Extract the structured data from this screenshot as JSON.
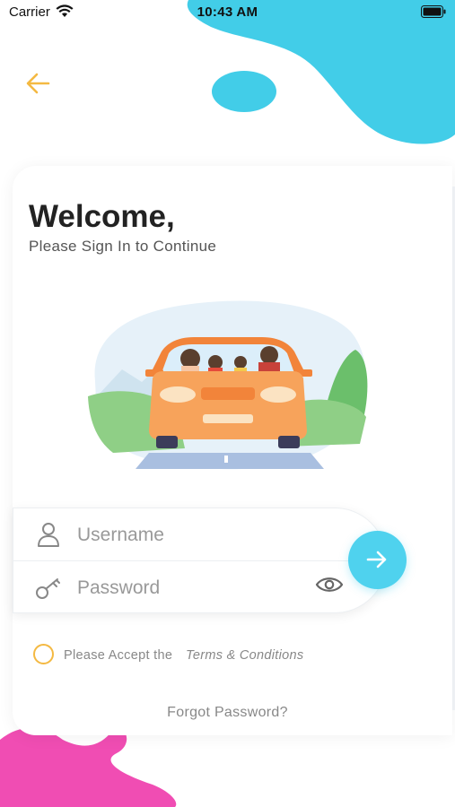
{
  "status_bar": {
    "carrier": "Carrier",
    "time": "10:43 AM"
  },
  "header": {
    "back_icon": "arrow-left-icon"
  },
  "welcome": {
    "title": "Welcome,",
    "subtitle": "Please Sign In to Continue"
  },
  "form": {
    "username_placeholder": "Username",
    "password_placeholder": "Password",
    "username_icon": "person-icon",
    "password_icon": "key-icon",
    "eye_icon": "eye-icon",
    "submit_icon": "arrow-right-icon"
  },
  "terms": {
    "prefix": "Please Accept the",
    "link": "Terms & Conditions"
  },
  "forgot_password": "Forgot Password?",
  "colors": {
    "accent_blue": "#4fd2ee",
    "accent_yellow": "#f4b942",
    "accent_pink": "#f04db3"
  }
}
